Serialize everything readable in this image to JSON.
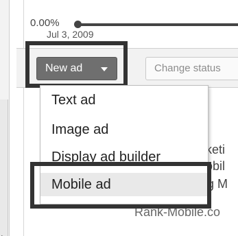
{
  "chart": {
    "y_label": "0.00%",
    "date_label": "Jul 3, 2009"
  },
  "toolbar": {
    "new_ad_label": "New ad",
    "change_status_label": "Change status"
  },
  "menu": {
    "items": [
      {
        "label": "Text ad"
      },
      {
        "label": "Image ad"
      },
      {
        "label": "Display ad builder"
      },
      {
        "label": "Mobile ad"
      }
    ]
  },
  "ad_preview": {
    "line1": "rketi",
    "line2": "obil",
    "line3": "g M",
    "url": "Rank-Mobile.co"
  }
}
